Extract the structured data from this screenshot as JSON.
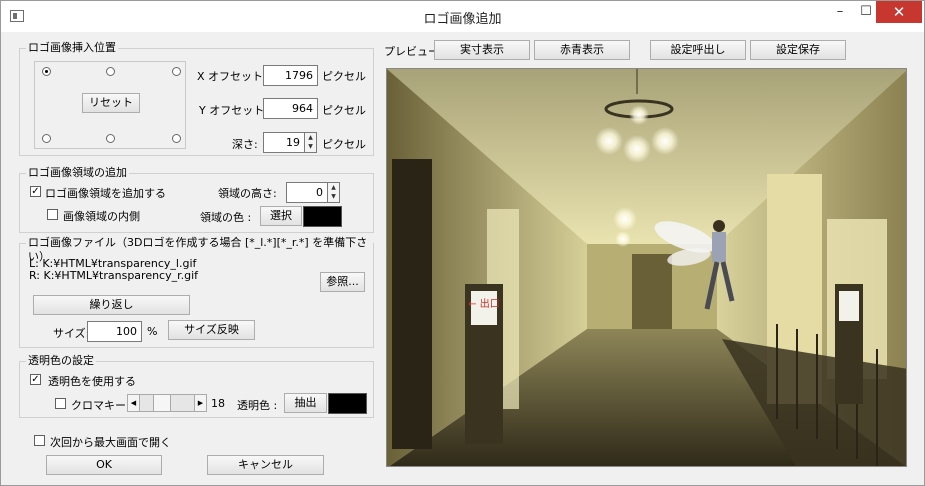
{
  "window": {
    "title": "ロゴ画像追加",
    "icon": "app-window-icon",
    "controls": {
      "minimize": "–",
      "maximize": "☐",
      "close": "✕"
    }
  },
  "position_group": {
    "title": "ロゴ画像挿入位置",
    "reset_label": "リセット",
    "anchor_selected": "top-left",
    "x_offset_label": "X オフセット:",
    "x_offset_value": "1796",
    "y_offset_label": "Y オフセット:",
    "y_offset_value": "964",
    "depth_label": "深さ:",
    "depth_value": "19",
    "unit_pixel": "ピクセル"
  },
  "area_group": {
    "title": "ロゴ画像領域の追加",
    "add_area_label": "ロゴ画像領域を追加する",
    "add_area_checked": true,
    "inside_label": "画像領域の内側",
    "inside_checked": false,
    "height_label": "領域の高さ:",
    "height_value": "0",
    "color_label": "領域の色 :",
    "select_label": "選択",
    "color_value": "#000000"
  },
  "file_group": {
    "title": "ロゴ画像ファイル（3Dロゴを作成する場合 [*_l.*][*_r.*] を準備下さい）",
    "left_file": "L: K:¥HTML¥transparency_l.gif",
    "right_file": "R: K:¥HTML¥transparency_r.gif",
    "browse_label": "参照...",
    "repeat_label": "繰り返し",
    "size_label": "サイズ:",
    "size_value": "100",
    "size_unit": "%",
    "apply_size_label": "サイズ反映"
  },
  "transparent_group": {
    "title": "透明色の設定",
    "use_label": "透明色を使用する",
    "use_checked": true,
    "chroma_label": "クロマキー",
    "chroma_checked": false,
    "slider_left": "◀",
    "slider_right": "▶",
    "chroma_value": "18",
    "transparent_color_label": "透明色 :",
    "extract_label": "抽出",
    "color_value": "#000000"
  },
  "bottom": {
    "maximize_label": "次回から最大画面で開く",
    "maximize_checked": false,
    "ok_label": "OK",
    "cancel_label": "キャンセル"
  },
  "preview_bar": {
    "label": "プレビュー",
    "actual_label": "実寸表示",
    "redblue_label": "赤青表示",
    "load_label": "設定呼出し",
    "save_label": "設定保存"
  },
  "preview": {
    "sign_text": "← 出口",
    "description": "hallway photo with winged figure"
  }
}
